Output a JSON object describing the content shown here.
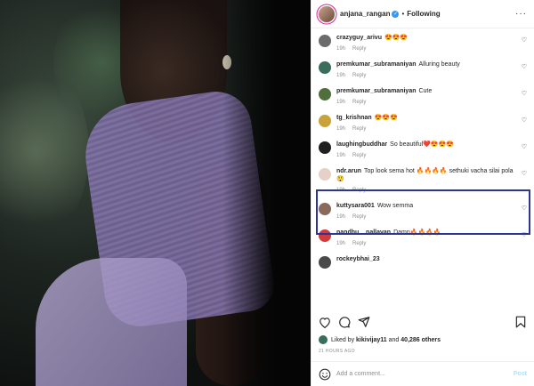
{
  "header": {
    "username": "anjana_rangan",
    "verified": "✓",
    "separator": "•",
    "follow_label": "Following",
    "more": "···"
  },
  "comments": [
    {
      "user": "crazyguy_arivu",
      "text": "😍😍😍",
      "time": "19h",
      "reply": "Reply"
    },
    {
      "user": "premkumar_subramaniyan",
      "text": "Alluring beauty",
      "time": "19h",
      "reply": "Reply"
    },
    {
      "user": "premkumar_subramaniyan",
      "text": "Cute",
      "time": "19h",
      "reply": "Reply"
    },
    {
      "user": "tg_krishnan",
      "text": "😍😍😍",
      "time": "19h",
      "reply": "Reply"
    },
    {
      "user": "laughingbuddhar",
      "text": "So beautiful❤️😍😍😍",
      "time": "19h",
      "reply": "Reply"
    },
    {
      "user": "ndr.arun",
      "text": "Top look sema hot 🔥🔥🔥🔥 sethuki vacha silai pola 😲",
      "time": "19h",
      "reply": "Reply"
    },
    {
      "user": "kuttysara001",
      "text": "Wow semma",
      "time": "19h",
      "reply": "Reply"
    },
    {
      "user": "nandhu__nallavan",
      "text": "Damn🔥🔥🔥🔥",
      "time": "19h",
      "reply": "Reply"
    },
    {
      "user": "rockeybhai_23",
      "text": "",
      "time": "",
      "reply": ""
    }
  ],
  "likes": {
    "prefix": "Liked by",
    "user": "kikivijay11",
    "joiner": "and",
    "count": "40,286 others"
  },
  "time_ago": "21 HOURS AGO",
  "add_comment": {
    "placeholder": "Add a comment...",
    "post_label": "Post"
  },
  "icons": {
    "more": "more-options-icon",
    "heart": "heart-icon",
    "comment": "comment-icon",
    "share": "share-icon",
    "save": "bookmark-icon",
    "emoji": "emoji-icon"
  },
  "colors": {
    "highlight_box": "#2d3593",
    "verified": "#3897f0",
    "post_button": "#b2dffc"
  }
}
